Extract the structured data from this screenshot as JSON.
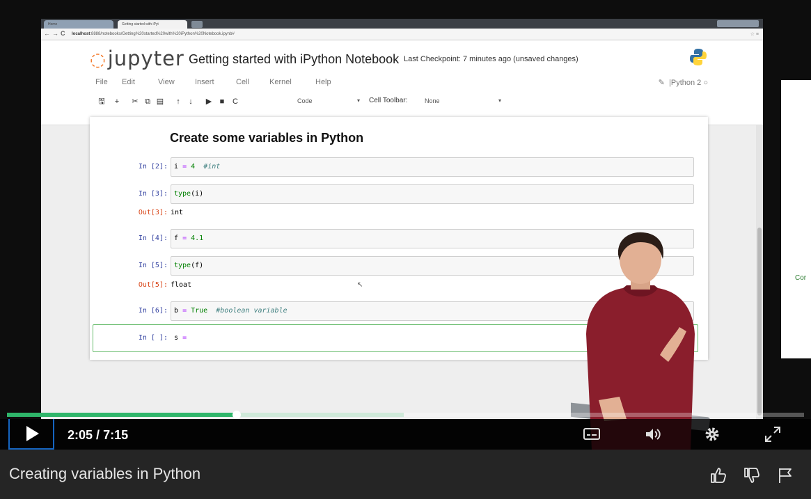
{
  "browser": {
    "tabs": [
      "Home",
      "Getting started with iPyt"
    ],
    "url_host": "localhost",
    "url_path": ":8888/notebooks/Getting%20started%20with%20iPython%20Notebook.ipynb#"
  },
  "jupyter": {
    "logo_text": "jupyter",
    "notebook_name": "Getting started with iPython Notebook",
    "checkpoint": "Last Checkpoint: 7 minutes ago (unsaved changes)",
    "menu": [
      "File",
      "Edit",
      "View",
      "Insert",
      "Cell",
      "Kernel",
      "Help"
    ],
    "kernel": "Python 2",
    "toolbar": {
      "cell_type": "Code",
      "cell_toolbar_label": "Cell Toolbar:",
      "cell_toolbar_value": "None"
    }
  },
  "notebook": {
    "heading": "Create some variables in Python",
    "cells": [
      {
        "in_prompt": "In [2]:",
        "code_var": "i",
        "code_op": "=",
        "code_val": "4",
        "code_comment": "#int"
      },
      {
        "in_prompt": "In [3]:",
        "code_fn": "type",
        "code_arg": "(i)",
        "out_prompt": "Out[3]:",
        "out_value": "int"
      },
      {
        "in_prompt": "In [4]:",
        "code_var": "f",
        "code_op": "=",
        "code_val": "4.1"
      },
      {
        "in_prompt": "In [5]:",
        "code_fn": "type",
        "code_arg": "(f)",
        "out_prompt": "Out[5]:",
        "out_value": "float"
      },
      {
        "in_prompt": "In [6]:",
        "code_var": "b",
        "code_op": "=",
        "code_val": "True",
        "code_comment": "#boolean variable"
      },
      {
        "in_prompt": "In [ ]:",
        "code_var": "s",
        "code_op": "="
      }
    ]
  },
  "side_slide": {
    "text": "Cor"
  },
  "player": {
    "current_time": "2:05",
    "separator": "/",
    "duration": "7:15",
    "played_fraction": 0.288,
    "buffered_fraction": 0.498
  },
  "video": {
    "title": "Creating variables in Python"
  },
  "colors": {
    "progress_played": "#2fb56a",
    "progress_buffer": "#cfe9d9",
    "jupyter_orange": "#f37726",
    "focus_blue": "#1565c0"
  },
  "icons": [
    "play-icon",
    "captions-icon",
    "volume-icon",
    "gear-icon",
    "fullscreen-icon",
    "thumbs-up-icon",
    "thumbs-down-icon",
    "flag-icon"
  ]
}
